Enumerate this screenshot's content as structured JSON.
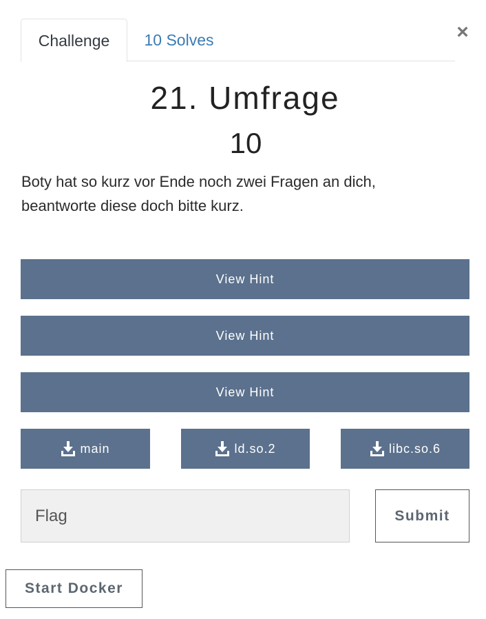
{
  "tabs": {
    "challenge_label": "Challenge",
    "solves_label": "10 Solves"
  },
  "close_glyph": "×",
  "challenge": {
    "title": "21. Umfrage",
    "points": "10",
    "description_line1": "Boty hat so kurz vor Ende noch zwei Fragen an dich,",
    "description_line2": "beantworte diese doch bitte kurz."
  },
  "hints": [
    {
      "label": "View Hint"
    },
    {
      "label": "View Hint"
    },
    {
      "label": "View Hint"
    }
  ],
  "files": [
    {
      "name": "main",
      "icon": "download-icon"
    },
    {
      "name": "ld.so.2",
      "icon": "download-icon"
    },
    {
      "name": "libc.so.6",
      "icon": "download-icon"
    }
  ],
  "flag": {
    "placeholder": "Flag",
    "value": ""
  },
  "submit_label": "Submit",
  "docker_label": "Start Docker",
  "colors": {
    "button_bg": "#5b718d",
    "link": "#3b7bb2"
  }
}
